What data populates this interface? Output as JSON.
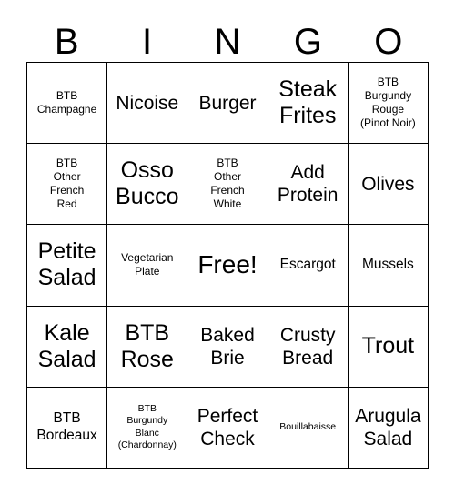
{
  "card": {
    "title": "Bingo Card",
    "header": {
      "letters": [
        "B",
        "I",
        "N",
        "G",
        "O"
      ]
    },
    "grid": {
      "rows": 5,
      "columns": 5,
      "border_color": "#000000",
      "background_color": "#ffffff",
      "text_color": "#000000",
      "free_space": {
        "row": 3,
        "column": 3,
        "label": "Free!"
      },
      "cells": [
        {
          "text": "BTB\nChampagne",
          "size": "small"
        },
        {
          "text": "Nicoise",
          "size": "large"
        },
        {
          "text": "Burger",
          "size": "large"
        },
        {
          "text": "Steak\nFrites",
          "size": "xlarge"
        },
        {
          "text": "BTB\nBurgundy\nRouge\n(Pinot Noir)",
          "size": "small"
        },
        {
          "text": "BTB\nOther\nFrench\nRed",
          "size": "small"
        },
        {
          "text": "Osso\nBucco",
          "size": "xlarge"
        },
        {
          "text": "BTB\nOther\nFrench\nWhite",
          "size": "small"
        },
        {
          "text": "Add\nProtein",
          "size": "large"
        },
        {
          "text": "Olives",
          "size": "large"
        },
        {
          "text": "Petite\nSalad",
          "size": "xlarge"
        },
        {
          "text": "Vegetarian\nPlate",
          "size": "small"
        },
        {
          "text": "Free!",
          "size": "huge"
        },
        {
          "text": "Escargot",
          "size": "medium"
        },
        {
          "text": "Mussels",
          "size": "medium"
        },
        {
          "text": "Kale\nSalad",
          "size": "xlarge"
        },
        {
          "text": "BTB\nRose",
          "size": "xlarge"
        },
        {
          "text": "Baked\nBrie",
          "size": "large"
        },
        {
          "text": "Crusty\nBread",
          "size": "large"
        },
        {
          "text": "Trout",
          "size": "xlarge"
        },
        {
          "text": "BTB\nBordeaux",
          "size": "medium"
        },
        {
          "text": "BTB\nBurgundy\nBlanc\n(Chardonnay)",
          "size": "xsmall"
        },
        {
          "text": "Perfect\nCheck",
          "size": "large"
        },
        {
          "text": "Bouillabaisse",
          "size": "xsmall"
        },
        {
          "text": "Arugula\nSalad",
          "size": "large"
        }
      ]
    }
  }
}
